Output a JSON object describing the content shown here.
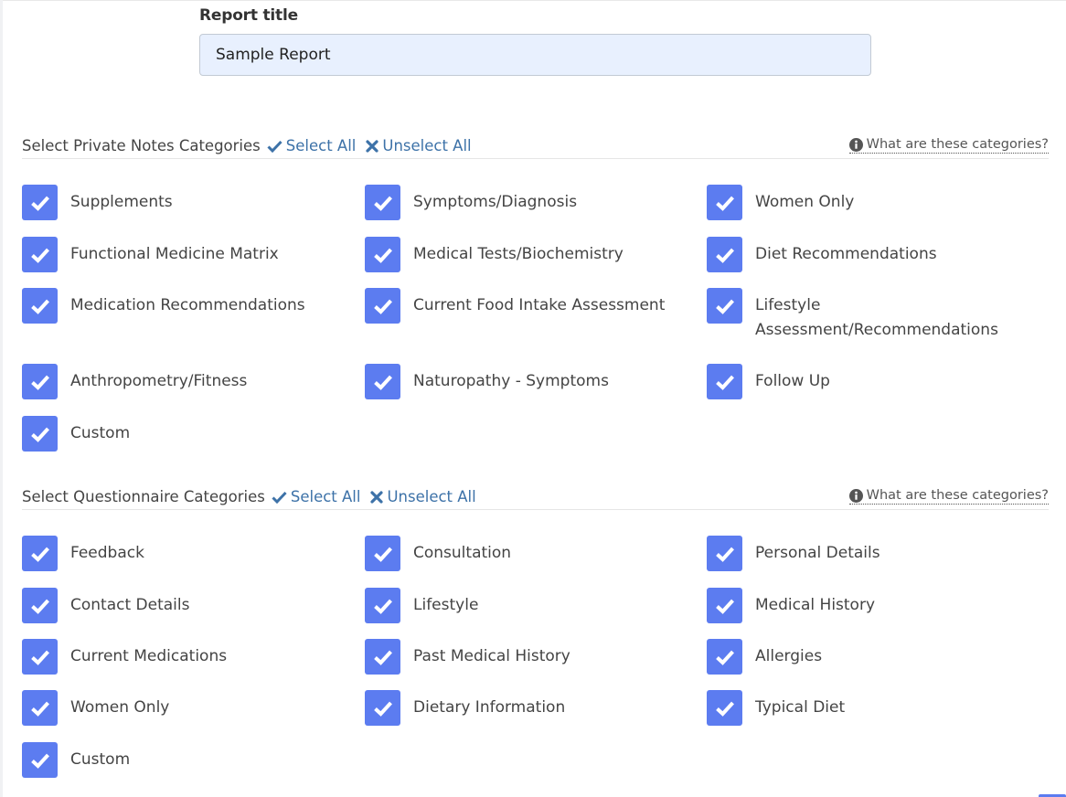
{
  "report": {
    "title_label": "Report title",
    "title_value": "Sample Report"
  },
  "private_notes": {
    "heading": "Select Private Notes Categories",
    "select_all": "Select All",
    "unselect_all": "Unselect All",
    "info_link": "What are these categories?",
    "items": [
      {
        "label": "Supplements",
        "checked": true
      },
      {
        "label": "Symptoms/Diagnosis",
        "checked": true
      },
      {
        "label": "Women Only",
        "checked": true
      },
      {
        "label": "Functional Medicine Matrix",
        "checked": true
      },
      {
        "label": "Medical Tests/Biochemistry",
        "checked": true
      },
      {
        "label": "Diet Recommendations",
        "checked": true
      },
      {
        "label": "Medication Recommendations",
        "checked": true
      },
      {
        "label": "Current Food Intake Assessment",
        "checked": true
      },
      {
        "label": "Lifestyle Assessment/Recommendations",
        "checked": true
      },
      {
        "label": "Anthropometry/Fitness",
        "checked": true
      },
      {
        "label": "Naturopathy - Symptoms",
        "checked": true
      },
      {
        "label": "Follow Up",
        "checked": true
      },
      {
        "label": "Custom",
        "checked": true
      }
    ]
  },
  "questionnaire": {
    "heading": "Select Questionnaire Categories",
    "select_all": "Select All",
    "unselect_all": "Unselect All",
    "info_link": "What are these categories?",
    "items": [
      {
        "label": "Feedback",
        "checked": true
      },
      {
        "label": "Consultation",
        "checked": true
      },
      {
        "label": "Personal Details",
        "checked": true
      },
      {
        "label": "Contact Details",
        "checked": true
      },
      {
        "label": "Lifestyle",
        "checked": true
      },
      {
        "label": "Medical History",
        "checked": true
      },
      {
        "label": "Current Medications",
        "checked": true
      },
      {
        "label": "Past Medical History",
        "checked": true
      },
      {
        "label": "Allergies",
        "checked": true
      },
      {
        "label": "Women Only",
        "checked": true
      },
      {
        "label": "Dietary Information",
        "checked": true
      },
      {
        "label": "Typical Diet",
        "checked": true
      },
      {
        "label": "Custom",
        "checked": true
      }
    ]
  },
  "colors": {
    "checkbox": "#5c7cf0",
    "link": "#3d72a8",
    "input_bg": "#e8f0fe"
  }
}
